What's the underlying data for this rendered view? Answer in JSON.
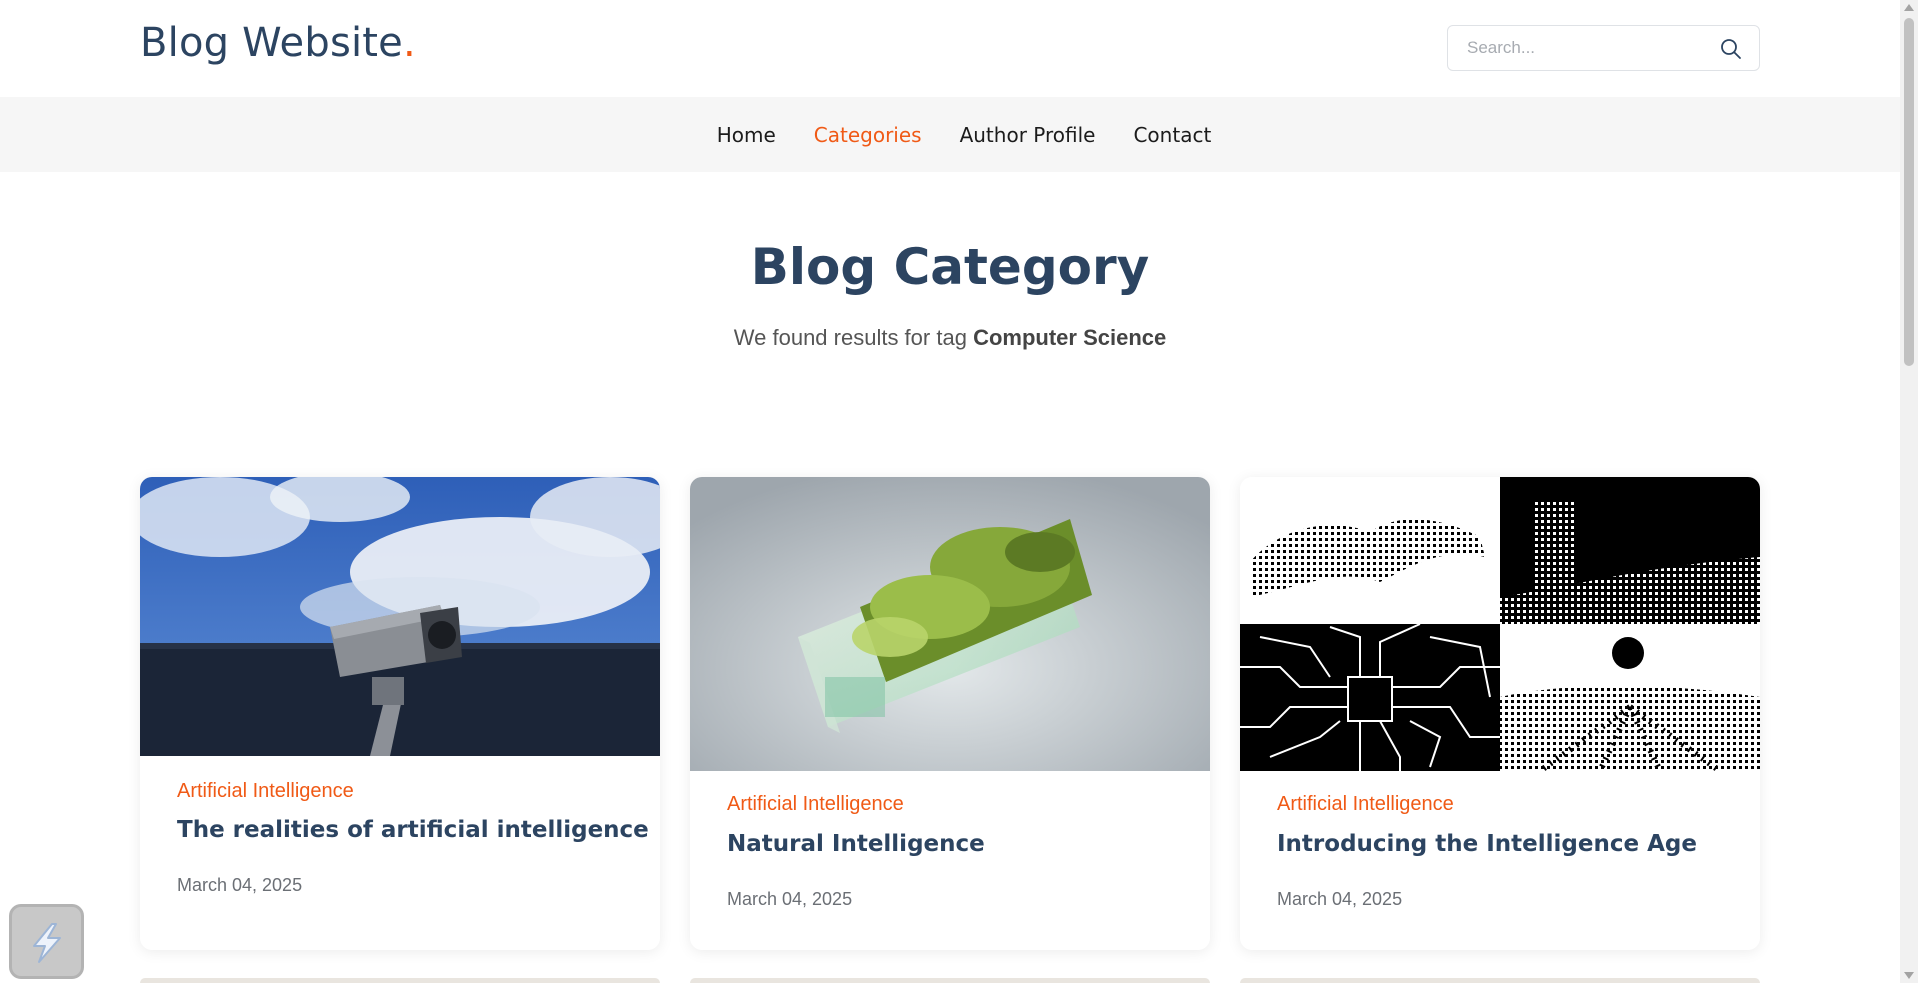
{
  "header": {
    "logo_text": "Blog Website",
    "logo_dot": ".",
    "search_placeholder": "Search..."
  },
  "nav": {
    "items": [
      {
        "label": "Home",
        "active": false
      },
      {
        "label": "Categories",
        "active": true
      },
      {
        "label": "Author Profile",
        "active": false
      },
      {
        "label": "Contact",
        "active": false
      }
    ]
  },
  "hero": {
    "title": "Blog Category",
    "subtitle_prefix": "We found results for tag",
    "tag": "Computer Science"
  },
  "posts": [
    {
      "category": "Artificial Intelligence",
      "title": "The realities of artificial intelligence",
      "date": "March 04, 2025",
      "image": "security-camera-sky"
    },
    {
      "category": "Artificial Intelligence",
      "title": "Natural Intelligence",
      "date": "March 04, 2025",
      "image": "mossy-glass-block"
    },
    {
      "category": "Artificial Intelligence",
      "title": "Introducing the Intelligence Age",
      "date": "March 04, 2025",
      "image": "pixel-art-collage"
    }
  ],
  "colors": {
    "accent": "#f05a16",
    "heading": "#2c4461",
    "nav_background": "#f6f6f6"
  },
  "icons": {
    "search": "search-icon",
    "widget": "lightning-widget-icon"
  }
}
